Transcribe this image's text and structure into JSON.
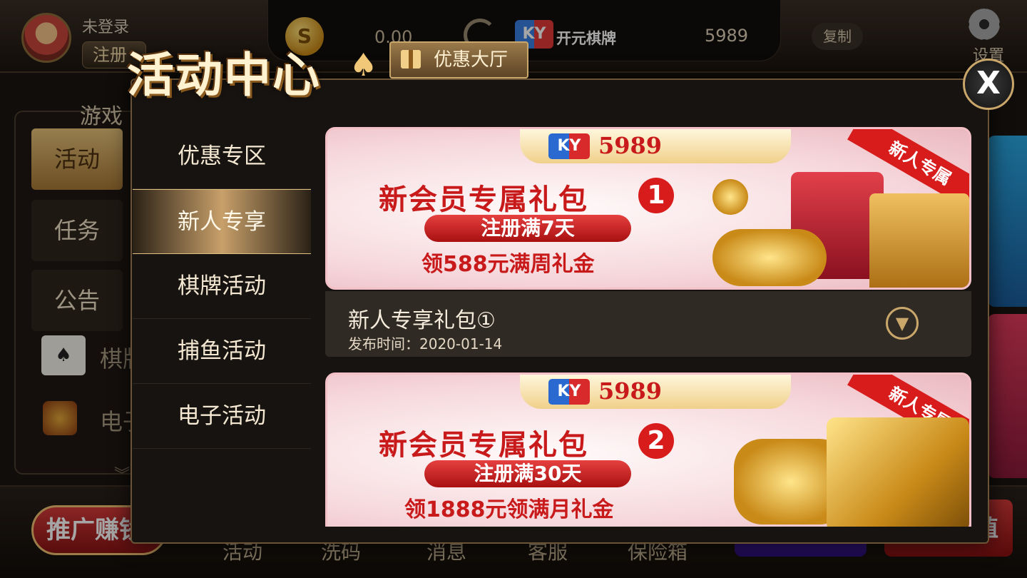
{
  "header": {
    "login_status": "未登录",
    "register_label": "注册",
    "balance": "0.00",
    "brand_logo": "KY",
    "brand_name": "开元棋牌",
    "site_id": "5989",
    "copy_label": "复制",
    "settings_label": "设置"
  },
  "lobby_side": {
    "header": "游戏",
    "tabs": [
      "活动",
      "任务",
      "公告"
    ],
    "items": [
      "棋牌",
      "电子"
    ]
  },
  "lobby_bottom": {
    "promo_label": "推广赚钱",
    "nav": [
      "活动",
      "洗码",
      "消息",
      "客服",
      "保险箱"
    ],
    "recharge_label": "充值"
  },
  "modal": {
    "title": "活动中心",
    "hall_badge": "优惠大厅",
    "close_label": "X",
    "menu": [
      {
        "label": "优惠专区",
        "active": false
      },
      {
        "label": "新人专享",
        "active": true
      },
      {
        "label": "棋牌活动",
        "active": false
      },
      {
        "label": "捕鱼活动",
        "active": false
      },
      {
        "label": "电子活动",
        "active": false
      }
    ],
    "banners": [
      {
        "logo": "KY",
        "number": "5989",
        "ribbon": "新人专属",
        "title": "新会员专属礼包",
        "badge": "1",
        "pill": "注册满7天",
        "reward": "领588元满周礼金"
      },
      {
        "logo": "KY",
        "number": "5989",
        "ribbon": "新人专属",
        "title": "新会员专属礼包",
        "badge": "2",
        "pill": "注册满30天",
        "reward": "领1888元领满月礼金"
      }
    ],
    "info": {
      "title": "新人专享礼包①",
      "date_label": "发布时间：",
      "date": "2020-01-14"
    }
  },
  "colors": {
    "gold_accent": "#c9a66a",
    "banner_red": "#c81a1a",
    "panel_bg": "#171310"
  }
}
